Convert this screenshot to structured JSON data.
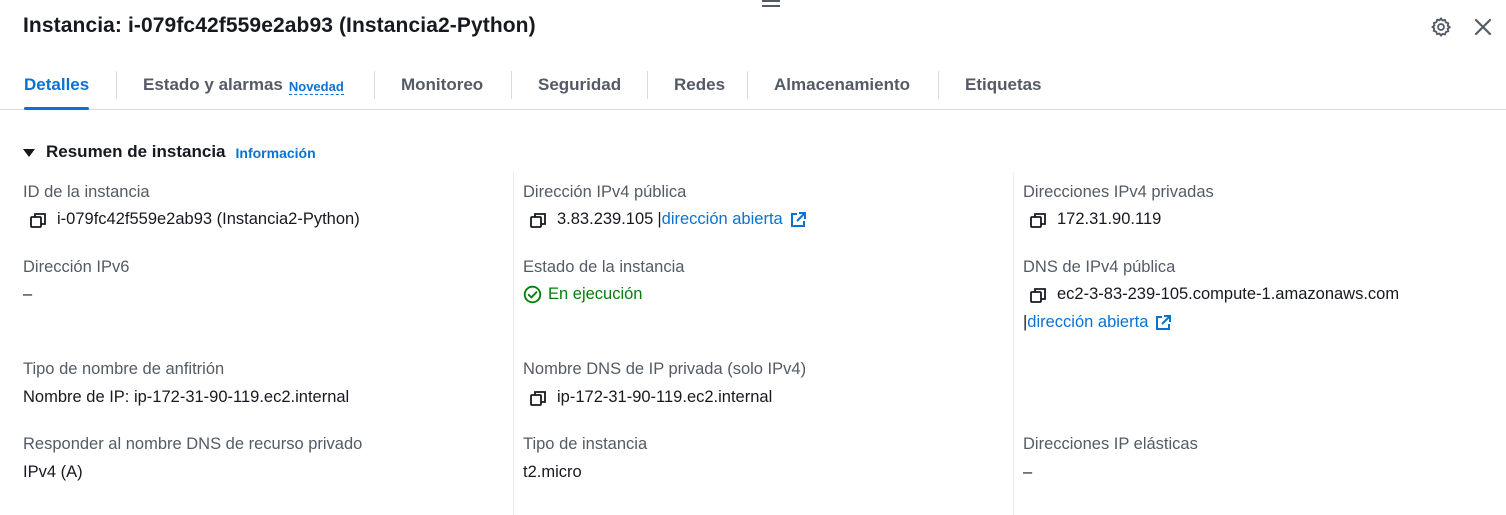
{
  "header": {
    "title": "Instancia: i-079fc42f559e2ab93 (Instancia2-Python)",
    "icons": [
      "drag-handle-icon",
      "gear-icon",
      "close-icon"
    ]
  },
  "tabs": [
    {
      "label": "Detalles",
      "active": true
    },
    {
      "label": "Estado y alarmas",
      "badge": "Novedad"
    },
    {
      "label": "Monitoreo"
    },
    {
      "label": "Seguridad"
    },
    {
      "label": "Redes"
    },
    {
      "label": "Almacenamiento"
    },
    {
      "label": "Etiquetas"
    }
  ],
  "section": {
    "title": "Resumen de instancia",
    "info_link": "Información"
  },
  "fields": {
    "instance_id": {
      "label": "ID de la instancia",
      "value": "i-079fc42f559e2ab93 (Instancia2-Python)"
    },
    "public_ipv4": {
      "label": "Dirección IPv4 pública",
      "value": "3.83.239.105",
      "sep": "|",
      "link": "dirección abierta"
    },
    "private_ipv4": {
      "label": "Direcciones IPv4 privadas",
      "value": "172.31.90.119"
    },
    "ipv6": {
      "label": "Dirección IPv6",
      "value": "–"
    },
    "state": {
      "label": "Estado de la instancia",
      "value": "En ejecución"
    },
    "public_dns": {
      "label": "DNS de IPv4 pública",
      "value": "ec2-3-83-239-105.compute-1.amazonaws.com",
      "sep": "|",
      "link": "dirección abierta"
    },
    "hostname_type": {
      "label": "Tipo de nombre de anfitrión",
      "value": "Nombre de IP: ip-172-31-90-119.ec2.internal"
    },
    "private_dns": {
      "label": "Nombre DNS de IP privada (solo IPv4)",
      "value": "ip-172-31-90-119.ec2.internal"
    },
    "resource_dns": {
      "label": "Responder al nombre DNS de recurso privado",
      "value": "IPv4 (A)"
    },
    "instance_type": {
      "label": "Tipo de instancia",
      "value": "t2.micro"
    },
    "elastic_ip": {
      "label": "Direcciones IP elásticas",
      "value": "–"
    }
  },
  "colors": {
    "accent": "#0972d3",
    "success": "#037f0c",
    "label": "#545b64",
    "text": "#16191f",
    "border": "#d5dbdb"
  }
}
